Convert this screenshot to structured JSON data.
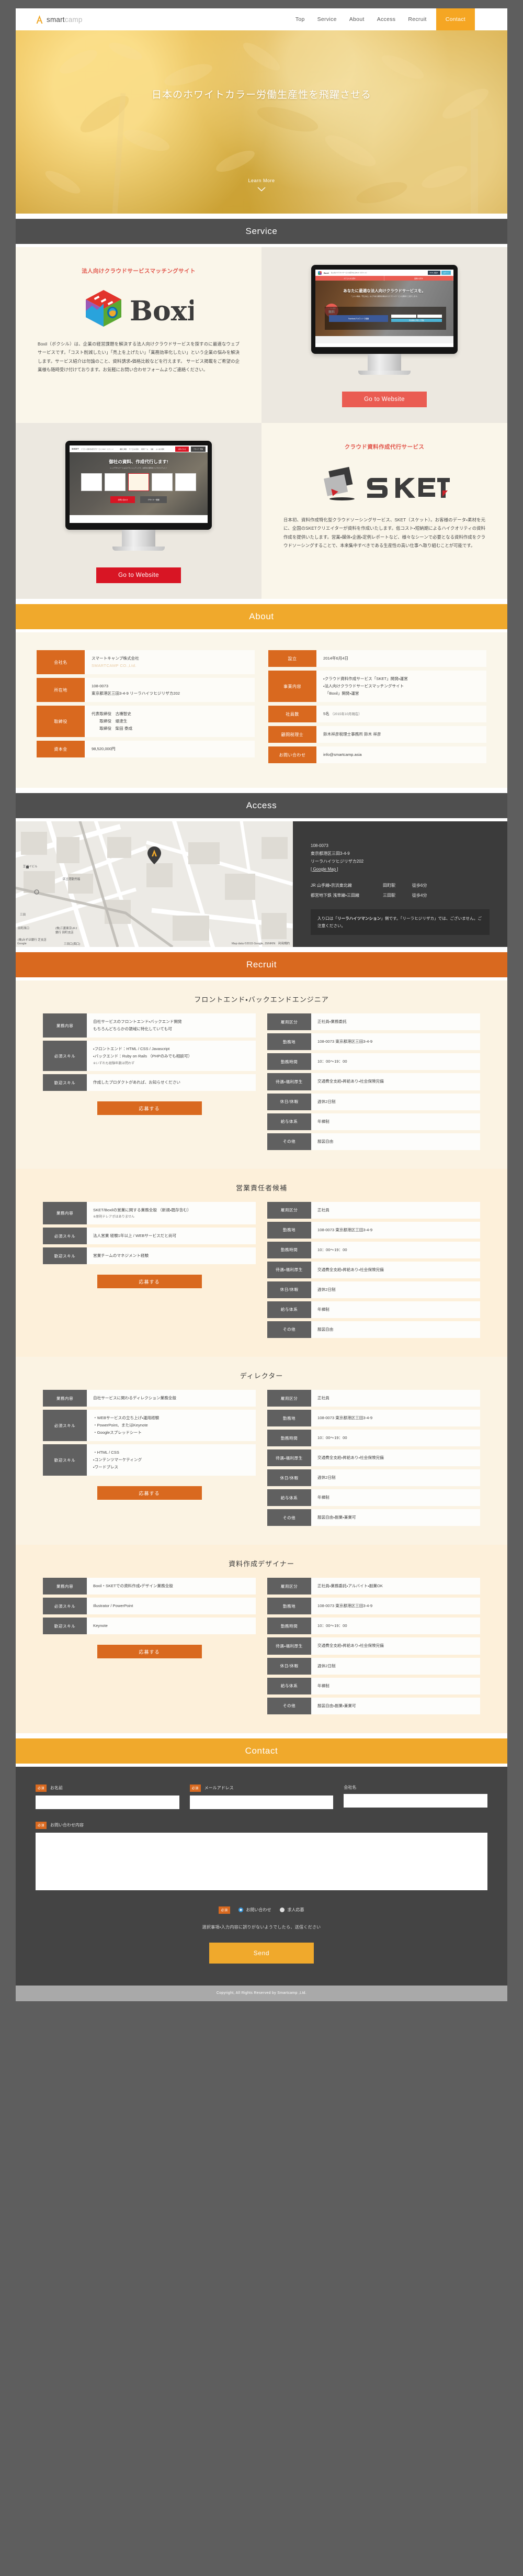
{
  "header": {
    "logo_main": "smart",
    "logo_accent": "camp",
    "nav": [
      {
        "label": "Top"
      },
      {
        "label": "Service"
      },
      {
        "label": "About"
      },
      {
        "label": "Access"
      },
      {
        "label": "Recruit"
      }
    ],
    "contact_label": "Contact"
  },
  "hero": {
    "title": "日本のホワイトカラー労働生産性を飛躍させる",
    "learn_more": "Learn More"
  },
  "sections": {
    "service": "Service",
    "about": "About",
    "access": "Access",
    "recruit": "Recruit",
    "contact": "Contact"
  },
  "services": [
    {
      "category": "法人向けクラウドサービスマッチングサイト",
      "logo_text": "Boxil",
      "description": "Boxil（ボクシル）は、企業の経営課題を解決する法人向けクラウドサービスを探すのに最適なウェブサービスです。「コスト削減したい」「売上を上げたい」「業務効率化したい」という企業の悩みを解決します。サービス紹介は勿論のこと、資料請求・価格比較などを行えます。 サービス掲載をご希望の企業様も随時受け付けております。お気軽にお問い合わせフォームよりご連絡ください。",
      "button": "Go to Website",
      "screen": {
        "logo": "Boxil",
        "tagline": "法人向けクラウドサービスを探すならBoxil（ボクシル）",
        "btn1": "Boxilに掲載す",
        "btn2": "ログイン",
        "nav1": "カテゴリから探す",
        "nav2": "業種から探す",
        "hero_title": "あなたに最適な法人向けクラウドサービスを。",
        "hero_sub": "「コスト削減」「売上向上」など今ある課題を解決するクラウドサービスを無料でご紹介します。",
        "badge_small": "トータル無料",
        "badge_big": "無料",
        "panel_title": "新規会員登録",
        "fb_btn": "Facebookアカウントで登録",
        "field_mail": "メールアドレスを入力",
        "field_pass": "パスワードを入力",
        "submit": "利用規約に同意して登録",
        "footnote": "上記サービスアカウントでの登録は、別途詳細情報の入力は、利用規約および、プライバシーポリシーに同意されたものとみなします。"
      }
    },
    {
      "category": "クラウド資料作成代行サービス",
      "logo_text": "SKET",
      "description": "日本初、資料作成特化型クラウドソーシングサービス、SKET（スケット）。お客様のデータ・素材を元に、全国のSKETクリエイターが資料を作成いたします。低コスト・短納期によるハイクオリティの資料作成を提供いたします。営業・媒体・企画・定例レポートなど、様々なシーンで必要となる資料作成をクラウドソーシングすることで、本来集中すべきである生産性の高い仕事へ取り組むことが可能です。",
      "button": "Go to Website",
      "screen": {
        "logo": "SKET",
        "tagline": "クラウド資料作成代行サービス SKET（スケット）",
        "menu": [
          "機能と特徴",
          "サービスの流れ",
          "制作チーム",
          "価格",
          "よくある質問"
        ],
        "btn1": "お問い合わせ",
        "btn2": "デザイナー登録",
        "hero_title": "御社の資料、作成代行します!",
        "hero_sub": "トップデザイナーによるブラッシュアップで、お持ちの資料をハイクオリティに！",
        "cta1": "お問い合わせ",
        "cta2": "デザイナー登録"
      }
    }
  ],
  "about": {
    "left": [
      {
        "key": "会社名",
        "value": "スマートキャンプ株式会社",
        "sub": "SMARTCAMP CO.,Ltd."
      },
      {
        "key": "所在地",
        "lines": [
          "108-0073",
          "東京都港区三田3-4-9 リーラハイツヒジリザカ202"
        ]
      },
      {
        "key": "取締役",
        "lines": [
          "代表取締役　古橋智史",
          "　　取締役　堤達生",
          "　　取締役　柴田 泰成"
        ]
      },
      {
        "key": "資本金",
        "value": "98,520,000円"
      }
    ],
    "right": [
      {
        "key": "設立",
        "value": "2014年6月4日"
      },
      {
        "key": "事業内容",
        "lines": [
          "・クラウド資料作成サービス「SKET」開発・運営",
          "・法人向けクラウドサービスマッチングサイト",
          "　「Boxil」開発・運営"
        ]
      },
      {
        "key": "社員数",
        "value": "5名",
        "sub": "（2015年10月現在）"
      },
      {
        "key": "顧問税理士",
        "value": "鈴木祥彦税理士事務所 鈴木 祥彦"
      },
      {
        "key": "お問い合わせ",
        "value": "info@smartcamp.asia"
      }
    ]
  },
  "access": {
    "postal": "108-0073",
    "address1": "東京都港区三田3-4-9",
    "address2": "リーラハイツヒジリザカ202",
    "map_link": "[ Google Map ]",
    "routes": [
      {
        "line": "JR 山手線・京浜東北線",
        "station": "田町駅",
        "walk": "徒歩6分"
      },
      {
        "line": "都営地下鉄 浅草線・三田線",
        "station": "三田駅",
        "walk": "徒歩4分"
      }
    ],
    "note_prefix": "入り口は「",
    "note_bold": "リーラハイツマンション",
    "note_suffix": "」側です。「リーラヒジリザカ」では、ございません。ご注意ください。",
    "map_attrib": "Google",
    "map_terms": "Map data ©2015 Google, ZENRIN　利用規約",
    "map_labels": [
      "芝ダイビル",
      "区立港勤労福",
      "三田",
      "田町西口",
      "(株)三菱東京UFJ銀行 田町支店",
      "(株)みずほ銀行 芝支店",
      "三田口(西口)",
      "田町",
      "KIOSK"
    ]
  },
  "recruit": {
    "apply_label": "応募する",
    "jobs": [
      {
        "title": "フロントエンド・バックエンドエンジニア",
        "left": [
          {
            "key": "業務内容",
            "lines": [
              "自社サービスのフロントエンド・バックエンド開発",
              "もちろんどちらかの領域に特化していても可"
            ]
          },
          {
            "key": "必須スキル",
            "lines": [
              "・フロントエンド：HTML / CSS / Javascript",
              "・バックエンド：Ruby on Rails （PHPのみでも相談可）"
            ],
            "note": "※いずれも経験年数は問わず"
          },
          {
            "key": "歓迎スキル",
            "lines": [
              "作成したプロダクトがあれば、お知らせください"
            ]
          }
        ],
        "right": [
          {
            "key": "雇用区分",
            "value": "正社員・業務委託"
          },
          {
            "key": "勤務地",
            "value": "108-0073 東京都港区三田3-4-9"
          },
          {
            "key": "勤務時間",
            "value": "10：00〜19：00"
          },
          {
            "key": "待遇・福利厚生",
            "value": "交通費全支給・昇給あり・社会保険完備"
          },
          {
            "key": "休日/休暇",
            "value": "週休2日制"
          },
          {
            "key": "給与体系",
            "value": "年棒制"
          },
          {
            "key": "その他",
            "value": "服装自由"
          }
        ]
      },
      {
        "title": "営業責任者候補",
        "left": [
          {
            "key": "業務内容",
            "lines": [
              "SKET/Boxilの営業に関する業務全般 （新規・既存含む）"
            ],
            "note": "※原則テレアポはありません"
          },
          {
            "key": "必須スキル",
            "lines": [
              "法人営業 経験1年以上 / WEBサービスだと尚可"
            ]
          },
          {
            "key": "歓迎スキル",
            "lines": [
              "営業チームのマネジメント経験"
            ]
          }
        ],
        "right": [
          {
            "key": "雇用区分",
            "value": "正社員"
          },
          {
            "key": "勤務地",
            "value": "108-0073 東京都港区三田3-4-9"
          },
          {
            "key": "勤務時間",
            "value": "10：00〜19：00"
          },
          {
            "key": "待遇・福利厚生",
            "value": "交通費全支給・昇給あり・社会保険完備"
          },
          {
            "key": "休日/休暇",
            "value": "週休2日制"
          },
          {
            "key": "給与体系",
            "value": "年棒制"
          },
          {
            "key": "その他",
            "value": "服装自由"
          }
        ]
      },
      {
        "title": "ディレクター",
        "left": [
          {
            "key": "業務内容",
            "lines": [
              "自社サービスに関わるディレクション業務全般"
            ]
          },
          {
            "key": "必須スキル",
            "lines": [
              "・WEBサービスの立ち上げ・運用経験",
              "・PowerPoint、またはKeynote",
              "・Googleスプレッドシート"
            ]
          },
          {
            "key": "歓迎スキル",
            "lines": [
              "・HTML / CSS",
              "・コンテンツマーケティング",
              "・ワードプレス"
            ]
          }
        ],
        "right": [
          {
            "key": "雇用区分",
            "value": "正社員"
          },
          {
            "key": "勤務地",
            "value": "108-0073 東京都港区三田3-4-9"
          },
          {
            "key": "勤務時間",
            "value": "10：00〜19：00"
          },
          {
            "key": "待遇・福利厚生",
            "value": "交通費全支給・昇給あり・社会保険完備"
          },
          {
            "key": "休日/休暇",
            "value": "週休2日制"
          },
          {
            "key": "給与体系",
            "value": "年棒制"
          },
          {
            "key": "その他",
            "value": "服装自由・副業・兼業可"
          }
        ]
      },
      {
        "title": "資料作成デザイナー",
        "left": [
          {
            "key": "業務内容",
            "lines": [
              "Boxil・SKETでの資料作成・デザイン業務全般"
            ]
          },
          {
            "key": "必須スキル",
            "lines": [
              "Illustrator / PowerPoint"
            ]
          },
          {
            "key": "歓迎スキル",
            "lines": [
              "Keynote"
            ]
          }
        ],
        "right": [
          {
            "key": "雇用区分",
            "value": "正社員・業務委託・アルバイト・副業OK"
          },
          {
            "key": "勤務地",
            "value": "108-0073 東京都港区三田3-4-9"
          },
          {
            "key": "勤務時間",
            "value": "10：00〜19：00"
          },
          {
            "key": "待遇・福利厚生",
            "value": "交通費全支給・昇給あり・社会保険完備"
          },
          {
            "key": "休日/休暇",
            "value": "週休2日制"
          },
          {
            "key": "給与体系",
            "value": "年棒制"
          },
          {
            "key": "その他",
            "value": "服装自由・副業・兼業可"
          }
        ]
      }
    ]
  },
  "contact": {
    "required_badge": "必須",
    "fields": [
      {
        "label": "お名前",
        "required": true,
        "value": ""
      },
      {
        "label": "メールアドレス",
        "required": true,
        "value": ""
      },
      {
        "label": "会社名",
        "required": false,
        "value": ""
      }
    ],
    "message_label": "お問い合わせ内容",
    "message_value": "",
    "radio_label_required": "必須",
    "radios": [
      {
        "label": "お問い合わせ",
        "checked": true
      },
      {
        "label": "求人応募",
        "checked": false
      }
    ],
    "hint": "選択事項・入力内容に誤りがないようでしたら、送信ください",
    "send_label": "Send"
  },
  "footer": {
    "copyright": "Copyright, All Rights Reserved by Smartcamp ,Ltd."
  },
  "colors": {
    "amber": "#f0a92c",
    "orange": "#d9691f",
    "dark": "#4f4f4f",
    "coral": "#ea5c52",
    "red": "#d81524",
    "cream": "#faf6ea"
  }
}
